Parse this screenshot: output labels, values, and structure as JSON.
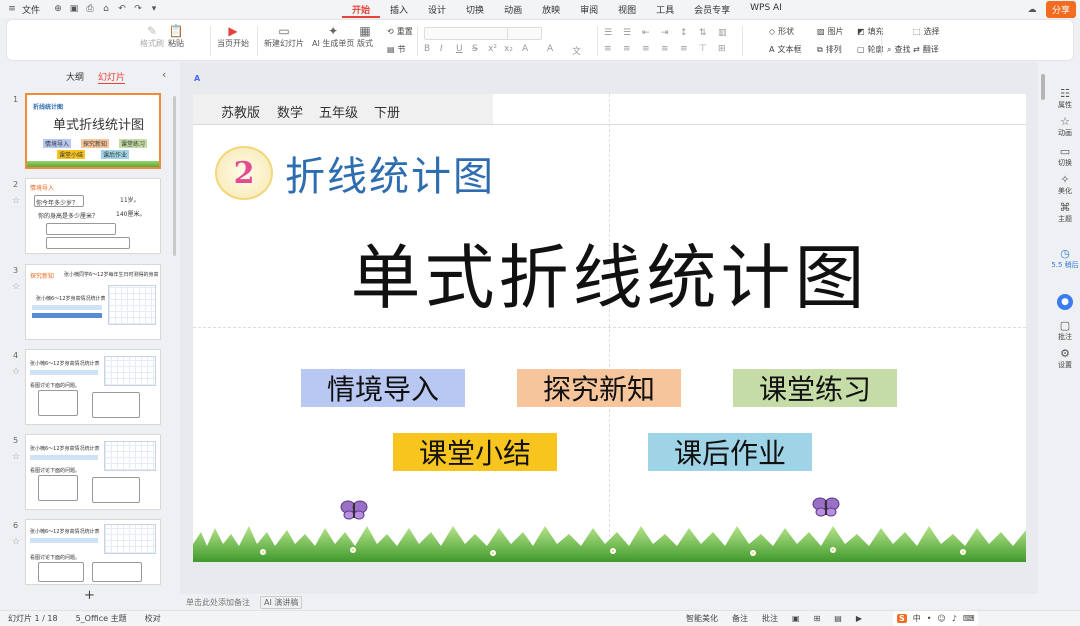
{
  "menubar": {
    "file_label": "文件",
    "tabs": [
      "开始",
      "插入",
      "设计",
      "切换",
      "动画",
      "放映",
      "审阅",
      "视图",
      "工具",
      "会员专享",
      "WPS AI"
    ],
    "active_tab": "开始",
    "share_label": "分享"
  },
  "ribbon": {
    "format_painter": "格式刷",
    "paste": "粘贴",
    "from_current": "当页开始",
    "new_slide": "新建幻灯片",
    "ai_generate": "AI 生成单页",
    "layout": "版式",
    "section": "节",
    "reset": "重置",
    "shape": "形状",
    "picture": "图片",
    "fill": "填充",
    "textbox": "文本框",
    "arrange": "排列",
    "outline": "轮廓",
    "select": "选择",
    "find": "查找",
    "translate": "翻译"
  },
  "leftpanel": {
    "tab_outline": "大纲",
    "tab_slides": "幻灯片",
    "add_symbol": "+"
  },
  "thumbs": {
    "t1_chapter": "折线统计图",
    "t1_title": "单式折线统计图",
    "t1_btns": [
      "情境导入",
      "探究新知",
      "课堂练习",
      "课堂小结",
      "课后作业"
    ],
    "t2_header": "情境导入",
    "t2_q": "你今年多少岁？",
    "t2_a1": "11岁。",
    "t2_a2": "140厘米。",
    "t2_text": "你的身高是多少厘米？",
    "t3_header": "探究新知",
    "t3_text": "张小楠同学6～12岁每年生日时测得的身高",
    "t3_chart_title": "张小楠6～12岁身高情况统计表",
    "t4_title": "张小楠6～12岁身高情况统计表",
    "t4_q": "看图讨论下面的问题。",
    "t5_title": "张小楠6～12岁身高情况统计表",
    "t5_q": "看图讨论下面的问题。",
    "t6_title": "张小楠6～12岁身高情况统计表",
    "t6_q": "看图讨论下面的问题。",
    "t6_a": "估计一下，张小楠13岁时的身高大约是多少厘米？"
  },
  "slide": {
    "edition": "苏教版",
    "subject": "数学",
    "grade": "五年级",
    "volume": "下册",
    "chapter_num": "2",
    "chapter_title": "折线统计图",
    "main_title": "单式折线统计图",
    "buttons": [
      {
        "label": "情境导入",
        "color": "#b9c8f3"
      },
      {
        "label": "探究新知",
        "color": "#f7c59b"
      },
      {
        "label": "课堂练习",
        "color": "#c5dca6"
      },
      {
        "label": "课堂小结",
        "color": "#f7c51e"
      },
      {
        "label": "课后作业",
        "color": "#9fd3e6"
      }
    ]
  },
  "rightbar": {
    "props": "属性",
    "anim": "动画",
    "switch": "切换",
    "beautify": "美化",
    "theme": "主题",
    "timer": "5.5\n稍后",
    "comment": "批注",
    "settings": "设置"
  },
  "notes": {
    "placeholder": "单击此处添加备注",
    "ai_speech": "AI 演讲稿"
  },
  "status": {
    "slide_count": "幻灯片 1 / 18",
    "theme": "5_Office 主题",
    "proofread": "校对",
    "smart_beautify": "智能美化",
    "remarks": "备注",
    "comments": "批注",
    "ime_s": "S",
    "ime_zh": "中"
  },
  "icons": {
    "star": "star-icon",
    "butterfly": "butterfly-icon",
    "collapse": "chevron-left-icon"
  }
}
